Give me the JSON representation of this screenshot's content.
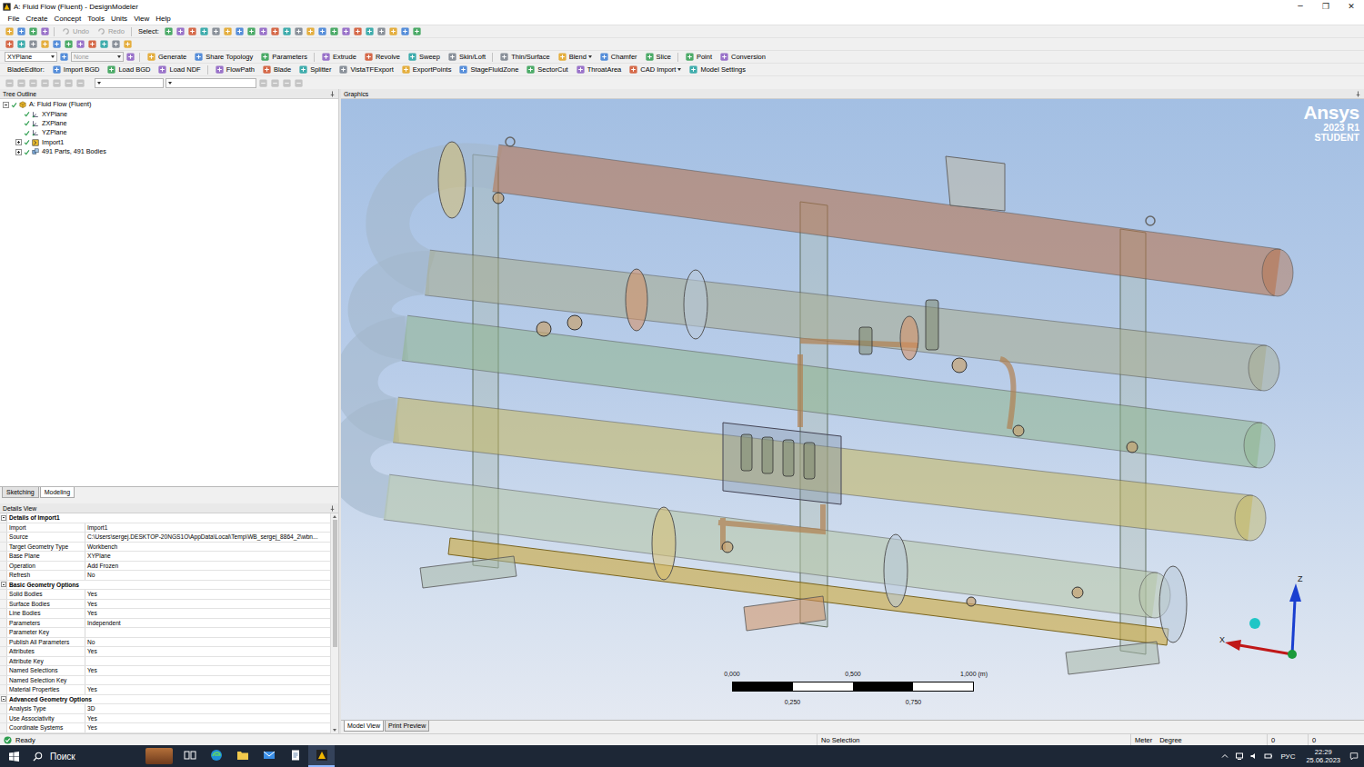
{
  "window": {
    "title": "A: Fluid Flow (Fluent) - DesignModeler",
    "controls": [
      "─",
      "❐",
      "✕"
    ]
  },
  "menu": [
    "File",
    "Create",
    "Concept",
    "Tools",
    "Units",
    "View",
    "Help"
  ],
  "toolbar_edit": {
    "buttons": [
      {
        "label": "Undo",
        "disabled": true
      },
      {
        "label": "Redo",
        "disabled": true
      }
    ],
    "select_label": "Select:"
  },
  "toolbar_features": {
    "plane": {
      "value": "XYPlane",
      "disabled": false
    },
    "sketch": {
      "value": "None",
      "disabled": true
    },
    "groups": [
      [
        {
          "label": "Generate",
          "dropdown": false
        },
        {
          "label": "Share Topology",
          "dropdown": false
        },
        {
          "label": "Parameters",
          "dropdown": false
        }
      ],
      [
        {
          "label": "Extrude",
          "dropdown": false
        },
        {
          "label": "Revolve",
          "dropdown": false
        },
        {
          "label": "Sweep",
          "dropdown": false
        },
        {
          "label": "Skin/Loft",
          "dropdown": false
        }
      ],
      [
        {
          "label": "Thin/Surface",
          "dropdown": false
        },
        {
          "label": "Blend",
          "dropdown": true
        },
        {
          "label": "Chamfer",
          "dropdown": false
        },
        {
          "label": "Slice",
          "dropdown": false
        }
      ],
      [
        {
          "label": "Point",
          "dropdown": false
        },
        {
          "label": "Conversion",
          "dropdown": false
        }
      ]
    ]
  },
  "toolbar_blade": {
    "label": "BladeEditor:",
    "groups": [
      [
        {
          "label": "Import BGD",
          "dropdown": false
        },
        {
          "label": "Load BGD",
          "dropdown": false
        },
        {
          "label": "Load NDF",
          "dropdown": false
        }
      ],
      [
        {
          "label": "FlowPath",
          "dropdown": false
        },
        {
          "label": "Blade",
          "dropdown": false
        },
        {
          "label": "Splitter",
          "dropdown": false
        },
        {
          "label": "VistaTFExport",
          "dropdown": false
        },
        {
          "label": "ExportPoints",
          "dropdown": false
        },
        {
          "label": "StageFluidZone",
          "dropdown": false
        },
        {
          "label": "SectorCut",
          "dropdown": false
        },
        {
          "label": "ThroatArea",
          "dropdown": false
        },
        {
          "label": "CAD Import",
          "dropdown": true
        },
        {
          "label": "Model Settings",
          "dropdown": false
        }
      ]
    ]
  },
  "tree": {
    "title": "Tree Outline",
    "items": [
      {
        "label": "A: Fluid Flow (Fluent)",
        "depth": 0,
        "kind": "model",
        "expandable": true,
        "expanded": true
      },
      {
        "label": "XYPlane",
        "depth": 1,
        "kind": "plane",
        "expandable": false,
        "expanded": false
      },
      {
        "label": "ZXPlane",
        "depth": 1,
        "kind": "plane",
        "expandable": false,
        "expanded": false
      },
      {
        "label": "YZPlane",
        "depth": 1,
        "kind": "plane",
        "expandable": false,
        "expanded": false
      },
      {
        "label": "Import1",
        "depth": 1,
        "kind": "import",
        "expandable": true,
        "expanded": false
      },
      {
        "label": "491 Parts, 491 Bodies",
        "depth": 1,
        "kind": "parts",
        "expandable": true,
        "expanded": false
      }
    ]
  },
  "panel_tabs": [
    {
      "label": "Sketching",
      "selected": false
    },
    {
      "label": "Modeling",
      "selected": true
    }
  ],
  "details": {
    "title": "Details View",
    "rows": [
      {
        "kind": "group",
        "label": "Details of Import1",
        "expanded": true
      },
      {
        "kind": "field",
        "label": "Import",
        "value": "Import1"
      },
      {
        "kind": "field",
        "label": "Source",
        "value": "C:\\Users\\sergej.DESKTOP-20NGS1O\\AppData\\Local\\Temp\\WB_sergej_8864_2\\wbn..."
      },
      {
        "kind": "field",
        "label": "Target Geometry Type",
        "value": "Workbench"
      },
      {
        "kind": "field",
        "label": "Base Plane",
        "value": "XYPlane"
      },
      {
        "kind": "field",
        "label": "Operation",
        "value": "Add Frozen"
      },
      {
        "kind": "field",
        "label": "Refresh",
        "value": "No"
      },
      {
        "kind": "group",
        "label": "Basic Geometry Options",
        "expanded": true
      },
      {
        "kind": "field",
        "label": "Solid Bodies",
        "value": "Yes"
      },
      {
        "kind": "field",
        "label": "Surface Bodies",
        "value": "Yes"
      },
      {
        "kind": "field",
        "label": "Line Bodies",
        "value": "Yes"
      },
      {
        "kind": "field",
        "label": "Parameters",
        "value": "Independent"
      },
      {
        "kind": "field",
        "label": "Parameter Key",
        "value": ""
      },
      {
        "kind": "field",
        "label": "Publish All Parameters",
        "value": "No"
      },
      {
        "kind": "field",
        "label": "Attributes",
        "value": "Yes"
      },
      {
        "kind": "field",
        "label": "Attribute Key",
        "value": ""
      },
      {
        "kind": "field",
        "label": "Named Selections",
        "value": "Yes"
      },
      {
        "kind": "field",
        "label": "Named Selection Key",
        "value": ""
      },
      {
        "kind": "field",
        "label": "Material Properties",
        "value": "Yes"
      },
      {
        "kind": "group",
        "label": "Advanced Geometry Options",
        "expanded": true
      },
      {
        "kind": "field",
        "label": "Analysis Type",
        "value": "3D"
      },
      {
        "kind": "field",
        "label": "Use Associativity",
        "value": "Yes"
      },
      {
        "kind": "field",
        "label": "Coordinate Systems",
        "value": "Yes"
      }
    ]
  },
  "graphics": {
    "title": "Graphics",
    "logo": {
      "name": "Ansys",
      "version": "2023 R1",
      "edition": "STUDENT"
    },
    "scale": {
      "top": [
        "0,000",
        "0,500",
        "1,000 (m)"
      ],
      "bottom": [
        "0,250",
        "0,750"
      ]
    },
    "axes": {
      "z": "Z",
      "x": "X"
    }
  },
  "view_tabs": [
    {
      "label": "Model View",
      "selected": true
    },
    {
      "label": "Print Preview",
      "selected": false
    }
  ],
  "status_bar": {
    "state": "Ready",
    "selection": "No Selection",
    "length_unit": "Meter",
    "angle_unit": "Degree",
    "values": [
      "0",
      "0"
    ]
  },
  "taskbar": {
    "search": "Поиск",
    "language": "РУС",
    "time": "22:29",
    "date": "25.06.2023"
  }
}
